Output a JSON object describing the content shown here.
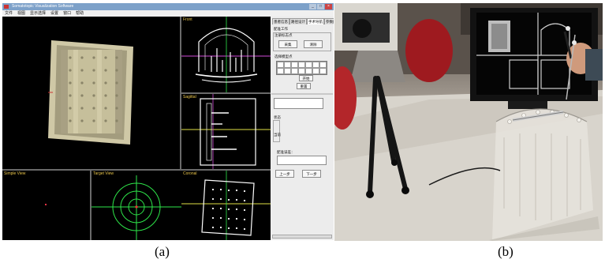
{
  "figure": {
    "captions": [
      "(a)",
      "(b)"
    ]
  },
  "window": {
    "title": "Somatotopic Visualization Software",
    "menu": [
      "文件",
      "视图",
      "显示选择",
      "设置",
      "窗口",
      "帮助"
    ]
  },
  "views": {
    "top_right": "Front",
    "middle_right": "Sagittal",
    "bottom_left": "Simple View",
    "bottom_middle": "Target View",
    "bottom_right": "Coronal"
  },
  "control_panel": {
    "tabs": [
      "患者信息",
      "路径设计",
      "手术导航",
      "参数配置"
    ],
    "section1_title": "配准工作",
    "group1_label": "注册标志点",
    "btn_acquire": "采集",
    "btn_clear": "清除",
    "group2_label": "选择模型点",
    "btn_start": "开始",
    "btn_reset": "重置",
    "label_status": "状态",
    "label_current": "当前",
    "label_error": "配准误差：",
    "btn_prev": "上一步",
    "btn_next": "下一步"
  },
  "icons": {
    "close": "close-icon",
    "maximize": "maximize-icon",
    "minimize": "minimize-icon",
    "crosshair": "crosshair-icon"
  },
  "colors": {
    "view_background": "#000000",
    "label_yellow": "#e8c44a",
    "crosshair_green": "#2ee64a",
    "axis_pink": "#d14bd9",
    "axis_yellow": "#e0e046",
    "model_cream": "#dcd4ae"
  }
}
